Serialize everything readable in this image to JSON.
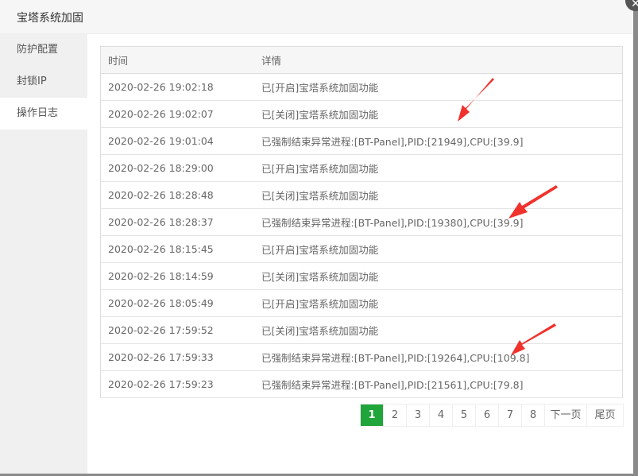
{
  "dialog": {
    "title": "宝塔系统加固",
    "close_icon": "close-icon"
  },
  "sidebar": {
    "items": [
      {
        "label": "防护配置"
      },
      {
        "label": "封锁IP"
      },
      {
        "label": "操作日志",
        "active": true
      }
    ]
  },
  "table": {
    "headers": [
      "时间",
      "详情"
    ],
    "rows": [
      [
        "2020-02-26 19:02:18",
        "已[开启]宝塔系统加固功能"
      ],
      [
        "2020-02-26 19:02:07",
        "已[关闭]宝塔系统加固功能"
      ],
      [
        "2020-02-26 19:01:04",
        "已强制结束异常进程:[BT-Panel],PID:[21949],CPU:[39.9]"
      ],
      [
        "2020-02-26 18:29:00",
        "已[开启]宝塔系统加固功能"
      ],
      [
        "2020-02-26 18:28:48",
        "已[关闭]宝塔系统加固功能"
      ],
      [
        "2020-02-26 18:28:37",
        "已强制结束异常进程:[BT-Panel],PID:[19380],CPU:[39.9]"
      ],
      [
        "2020-02-26 18:15:45",
        "已[开启]宝塔系统加固功能"
      ],
      [
        "2020-02-26 18:14:59",
        "已[关闭]宝塔系统加固功能"
      ],
      [
        "2020-02-26 18:05:49",
        "已[开启]宝塔系统加固功能"
      ],
      [
        "2020-02-26 17:59:52",
        "已[关闭]宝塔系统加固功能"
      ],
      [
        "2020-02-26 17:59:33",
        "已强制结束异常进程:[BT-Panel],PID:[19264],CPU:[109.8]"
      ],
      [
        "2020-02-26 17:59:23",
        "已强制结束异常进程:[BT-Panel],PID:[21561],CPU:[79.8]"
      ]
    ]
  },
  "pagination": {
    "pages": [
      "1",
      "2",
      "3",
      "4",
      "5",
      "6",
      "7",
      "8"
    ],
    "current": "1",
    "next": "下一页",
    "last": "尾页"
  },
  "colors": {
    "accent": "#20a53a",
    "annotation_arrow": "#f0322d"
  }
}
